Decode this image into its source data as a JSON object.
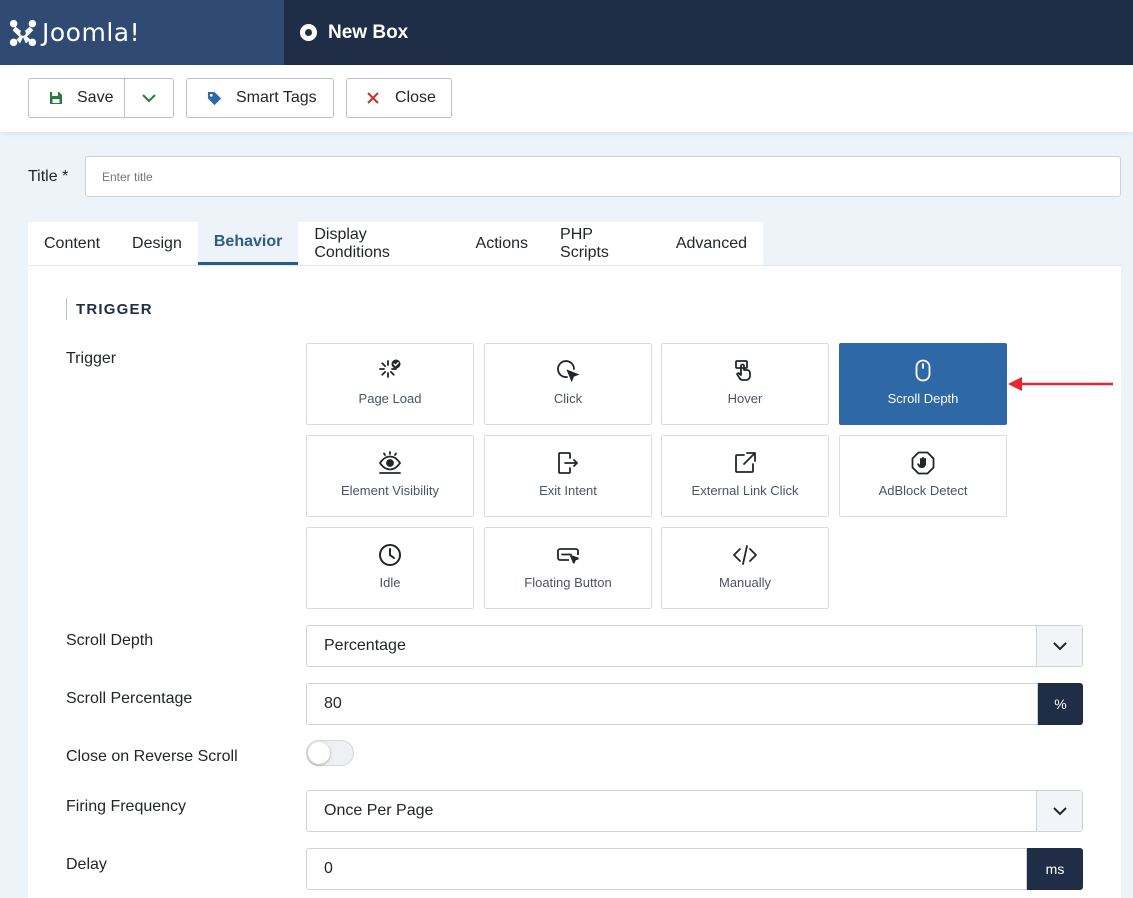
{
  "header": {
    "brand": "Joomla!",
    "page_title": "New Box"
  },
  "toolbar": {
    "save_label": "Save",
    "smart_tags_label": "Smart Tags",
    "close_label": "Close"
  },
  "title_field": {
    "label": "Title *",
    "placeholder": "Enter title",
    "value": ""
  },
  "tabs": [
    {
      "label": "Content"
    },
    {
      "label": "Design"
    },
    {
      "label": "Behavior"
    },
    {
      "label": "Display Conditions"
    },
    {
      "label": "Actions"
    },
    {
      "label": "PHP Scripts"
    },
    {
      "label": "Advanced"
    }
  ],
  "active_tab": "Behavior",
  "section": {
    "heading": "TRIGGER"
  },
  "trigger": {
    "label": "Trigger",
    "selected": "Scroll Depth",
    "options": [
      {
        "label": "Page Load",
        "icon": "page-load-icon"
      },
      {
        "label": "Click",
        "icon": "click-icon"
      },
      {
        "label": "Hover",
        "icon": "hover-icon"
      },
      {
        "label": "Scroll Depth",
        "icon": "mouse-icon"
      },
      {
        "label": "Element Visibility",
        "icon": "eye-icon"
      },
      {
        "label": "Exit Intent",
        "icon": "exit-icon"
      },
      {
        "label": "External Link Click",
        "icon": "external-link-icon"
      },
      {
        "label": "AdBlock Detect",
        "icon": "adblock-icon"
      },
      {
        "label": "Idle",
        "icon": "clock-icon"
      },
      {
        "label": "Floating Button",
        "icon": "floating-button-icon"
      },
      {
        "label": "Manually",
        "icon": "code-icon"
      }
    ]
  },
  "fields": {
    "scroll_depth": {
      "label": "Scroll Depth",
      "value": "Percentage"
    },
    "scroll_percentage": {
      "label": "Scroll Percentage",
      "value": "80",
      "unit": "%"
    },
    "close_on_reverse": {
      "label": "Close on Reverse Scroll",
      "enabled": false
    },
    "firing_frequency": {
      "label": "Firing Frequency",
      "value": "Once Per Page"
    },
    "delay": {
      "label": "Delay",
      "value": "0",
      "unit": "ms"
    }
  },
  "colors": {
    "topbar": "#1f2d47",
    "brand_bg": "#2f4b73",
    "selected_tile": "#2e68a6",
    "annotation_arrow": "#e8262b"
  }
}
